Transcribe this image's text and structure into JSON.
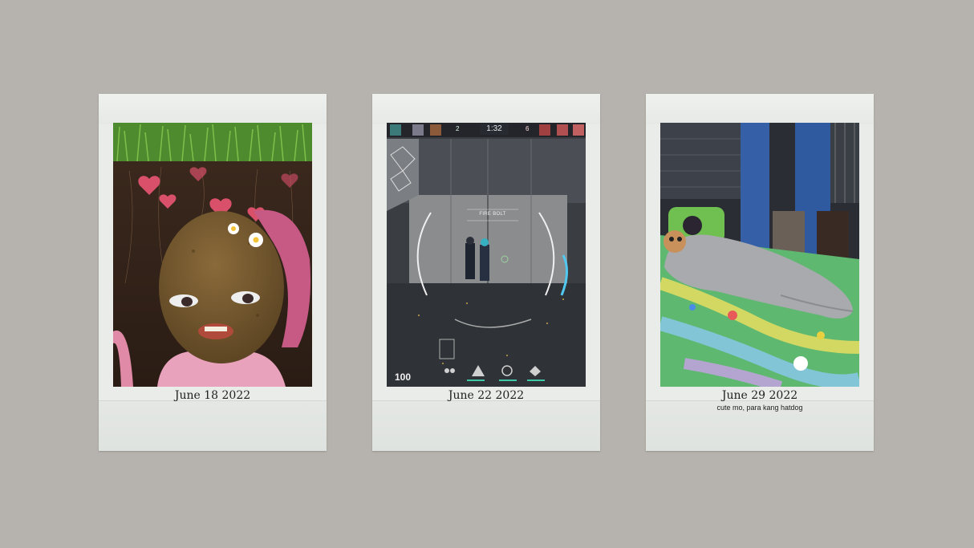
{
  "polaroids": [
    {
      "caption": "June 18 2022",
      "subcaption": "",
      "icon": "potato-face-photo"
    },
    {
      "caption": "June 22 2022",
      "subcaption": "",
      "icon": "game-screenshot-photo",
      "hud": {
        "timer": "1:32",
        "score_left": "2",
        "score_right": "6",
        "ability_label": "FIRE BOLT",
        "health": "100"
      }
    },
    {
      "caption": "June 29 2022",
      "subcaption": "cute mo, para kang hatdog",
      "icon": "sleeping-on-bed-photo"
    }
  ],
  "colors": {
    "background": "#b6b2ad",
    "frame": "#e9ece9"
  }
}
